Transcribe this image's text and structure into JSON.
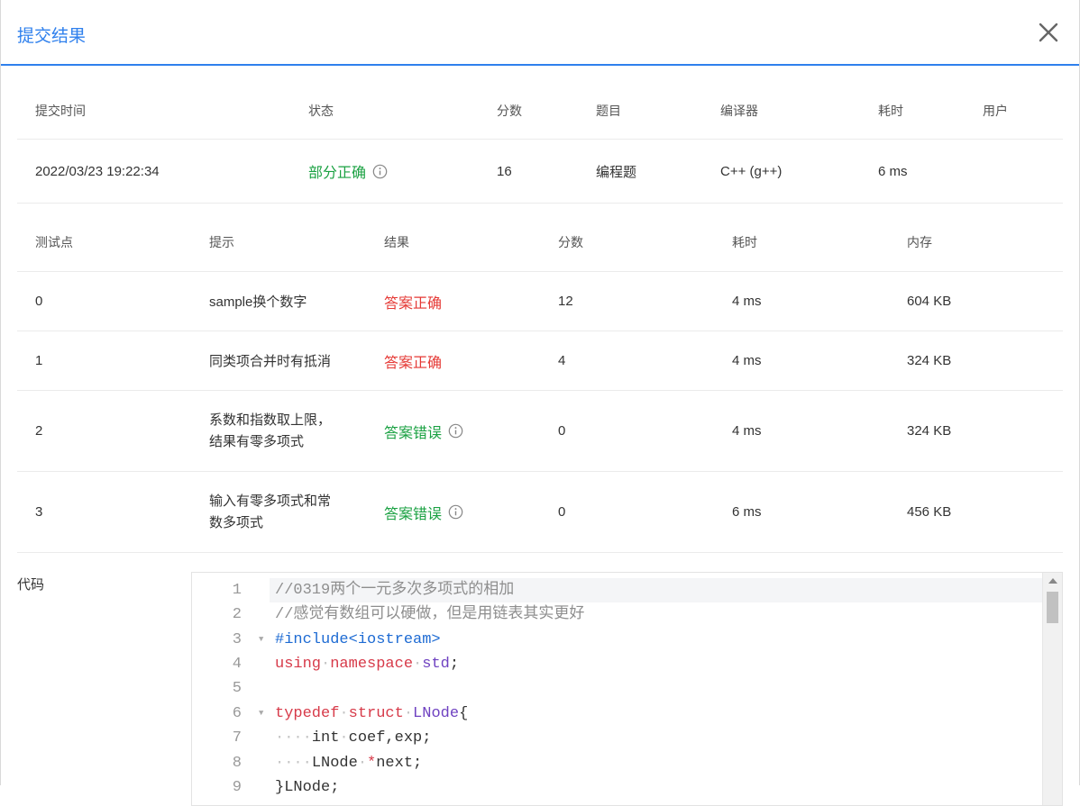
{
  "dialog": {
    "title": "提交结果",
    "close_icon": "close-icon"
  },
  "summary": {
    "headers": [
      "提交时间",
      "状态",
      "分数",
      "题目",
      "编译器",
      "耗时",
      "用户"
    ],
    "row": {
      "time": "2022/03/23 19:22:34",
      "status": "部分正确",
      "score": "16",
      "problem": "编程题",
      "compiler": "C++ (g++)",
      "duration": "6 ms",
      "user": ""
    }
  },
  "testcases": {
    "headers": [
      "测试点",
      "提示",
      "结果",
      "分数",
      "耗时",
      "内存"
    ],
    "rows": [
      {
        "id": "0",
        "hint": "sample换个数字",
        "hint2": "",
        "result": "答案正确",
        "result_color": "#e53935",
        "score": "12",
        "time": "4 ms",
        "memory": "604 KB"
      },
      {
        "id": "1",
        "hint": "同类项合并时有抵消",
        "hint2": "",
        "result": "答案正确",
        "result_color": "#e53935",
        "score": "4",
        "time": "4 ms",
        "memory": "324 KB"
      },
      {
        "id": "2",
        "hint": "系数和指数取上限，",
        "hint2": "结果有零多项式",
        "result": "答案错误",
        "result_color": "#1aa142",
        "score": "0",
        "time": "4 ms",
        "memory": "324 KB"
      },
      {
        "id": "3",
        "hint": "输入有零多项式和常",
        "hint2": "数多项式",
        "result": "答案错误",
        "result_color": "#1aa142",
        "score": "0",
        "time": "6 ms",
        "memory": "456 KB"
      }
    ]
  },
  "code": {
    "label": "代码",
    "lines": [
      {
        "n": "1",
        "text": "//0319两个一元多次多项式的相加"
      },
      {
        "n": "2",
        "text": "//感觉有数组可以硬做，但是用链表其实更好"
      },
      {
        "n": "3",
        "text": "#include<iostream>"
      },
      {
        "n": "4",
        "text": "using namespace std;"
      },
      {
        "n": "5",
        "text": ""
      },
      {
        "n": "6",
        "text": "typedef struct LNode{"
      },
      {
        "n": "7",
        "text": "    int coef,exp;"
      },
      {
        "n": "8",
        "text": "    LNode *next;"
      },
      {
        "n": "9",
        "text": "}LNode;"
      }
    ]
  },
  "colors": {
    "accent": "#2f80ed",
    "correct": "#e53935",
    "partial": "#1aa142"
  }
}
